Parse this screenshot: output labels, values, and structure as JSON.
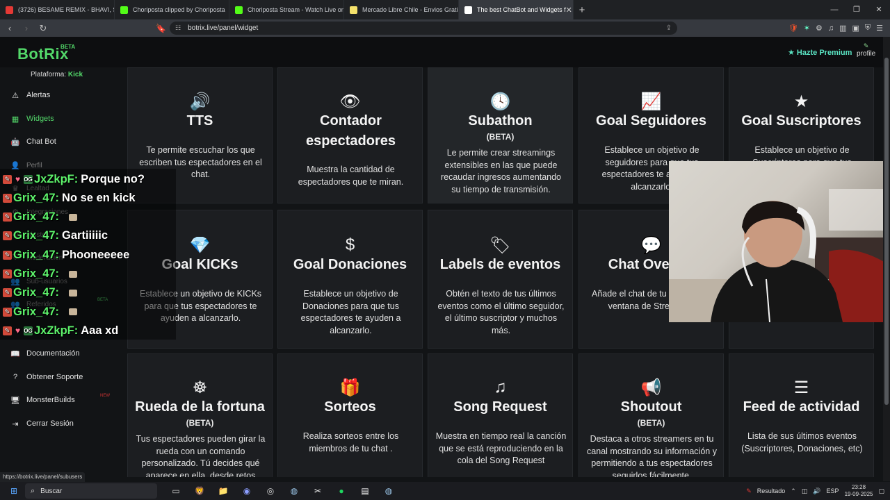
{
  "browser": {
    "tabs": [
      {
        "label": "(3726) BESAME REMIX - BHAVI, S",
        "color": "#e53935"
      },
      {
        "label": "Choriposta clipped by Choriposta",
        "color": "#53fc18"
      },
      {
        "label": "Choriposta Stream - Watch Live on K",
        "color": "#53fc18"
      },
      {
        "label": "Mercado Libre Chile - Envios Gratis e",
        "color": "#f5e26b"
      },
      {
        "label": "The best ChatBot and Widgets f",
        "color": "#ffffff"
      }
    ],
    "url": "botrix.live/panel/widget",
    "status_url": "https://botrix.live/panel/subusers"
  },
  "header": {
    "logo": "BotRix",
    "beta": "BETA",
    "premium": "Hazte Premium",
    "profile": "profile"
  },
  "sidebar": {
    "platform_label": "Plataforma:",
    "platform_value": "Kick",
    "items": [
      {
        "label": "Alertas",
        "icon": "warning-icon",
        "glyph": "⚠"
      },
      {
        "label": "Widgets",
        "icon": "grid-icon",
        "glyph": "▦"
      },
      {
        "label": "Chat Bot",
        "icon": "robot-icon",
        "glyph": "🤖"
      },
      {
        "label": "Perfil",
        "icon": "user-icon",
        "glyph": "👤"
      },
      {
        "label": "Lealtad",
        "icon": "loyalty-icon",
        "glyph": "♛"
      },
      {
        "label": "Integraciones",
        "icon": "plug-icon",
        "glyph": "⚙"
      },
      {
        "label": "Ajustes",
        "icon": "settings-icon",
        "glyph": "⚙"
      },
      {
        "label": "Moderación",
        "icon": "shield-icon",
        "glyph": "⛨"
      },
      {
        "label": "Sub-usuarios",
        "icon": "users-icon",
        "glyph": "👥"
      },
      {
        "label": "Referidos",
        "icon": "referral-icon",
        "glyph": "👥"
      },
      {
        "label": "Documentación",
        "icon": "book-icon",
        "glyph": "📖"
      },
      {
        "label": "Obtener Soporte",
        "icon": "help-icon",
        "glyph": "?"
      },
      {
        "label": "MonsterBuilds",
        "icon": "monitor-icon",
        "glyph": "🖥"
      },
      {
        "label": "Cerrar Sesión",
        "icon": "logout-icon",
        "glyph": "⇥"
      }
    ],
    "new_badge": "NEW",
    "beta_badge": "BETA"
  },
  "widgets": [
    {
      "title": "TTS",
      "beta": "",
      "desc": "Te permite escuchar los que escriben tus espectadores en el chat.",
      "icon": "speaker-icon",
      "glyph": "🔊"
    },
    {
      "title": "Contador espectadores",
      "beta": "",
      "desc": "Muestra la cantidad de espectadores que te miran.",
      "icon": "eye-icon",
      "glyph": "👁"
    },
    {
      "title": "Subathon",
      "beta": "(BETA)",
      "desc": "Le permite crear streamings extensibles en las que puede recaudar ingresos aumentando su tiempo de transmisión.",
      "icon": "clock-icon",
      "glyph": "🕓"
    },
    {
      "title": "Goal Seguidores",
      "beta": "",
      "desc": "Establece un objetivo de seguidores para que tus espectadores te ayuden a alcanzarlo.",
      "icon": "chart-line-icon",
      "glyph": "📈"
    },
    {
      "title": "Goal Suscriptores",
      "beta": "",
      "desc": "Establece un objetivo de Suscriptores para que tus espectadores te ayuden a alcanzarlo.",
      "icon": "star-icon",
      "glyph": "★"
    },
    {
      "title": "Goal KICKs",
      "beta": "",
      "desc": "Establece un objetivo de KICKs para que tus espectadores te ayuden a alcanzarlo.",
      "icon": "diamond-icon",
      "glyph": "💎"
    },
    {
      "title": "Goal Donaciones",
      "beta": "",
      "desc": "Establece un objetivo de Donaciones para que tus espectadores te ayuden a alcanzarlo.",
      "icon": "dollar-icon",
      "glyph": "$"
    },
    {
      "title": "Labels de eventos",
      "beta": "",
      "desc": "Obtén el texto de tus últimos eventos como el último seguidor, el último suscriptor y muchos más.",
      "icon": "tags-icon",
      "glyph": "🏷"
    },
    {
      "title": "Chat Overlay",
      "beta": "",
      "desc": "Añade el chat de tu stream a la ventana de Streaming.",
      "icon": "comment-icon",
      "glyph": "💬"
    },
    {
      "title": "",
      "beta": "",
      "desc": "",
      "icon": "",
      "glyph": ""
    },
    {
      "title": "Rueda de la fortuna",
      "beta": "(BETA)",
      "desc": "Tus espectadores pueden girar la rueda con un comando personalizado. Tú decides qué aparece en ella, desde retos hasta",
      "icon": "wheel-icon",
      "glyph": "☸"
    },
    {
      "title": "Sorteos",
      "beta": "",
      "desc": "Realiza sorteos entre los miembros de tu chat .",
      "icon": "gifts-icon",
      "glyph": "🎁"
    },
    {
      "title": "Song Request",
      "beta": "",
      "desc": "Muestra en tiempo real la canción que se está reproduciendo en la cola del Song Request",
      "icon": "music-icon",
      "glyph": "♫"
    },
    {
      "title": "Shoutout",
      "beta": "(BETA)",
      "desc": "Destaca a otros streamers en tu canal mostrando su información y permitiendo a tus espectadores seguirlos fácilmente.",
      "icon": "megaphone-icon",
      "glyph": "📢"
    },
    {
      "title": "Feed de actividad",
      "beta": "",
      "desc": "Lista de sus últimos eventos (Suscriptores, Donaciones, etc)",
      "icon": "list-icon",
      "glyph": "☰"
    }
  ],
  "chat": [
    {
      "user": "JxZkpF:",
      "msg": "Porque no?",
      "og": true,
      "emote": false
    },
    {
      "user": "Grix_47:",
      "msg": "No se en kick",
      "og": false,
      "emote": false
    },
    {
      "user": "Grix_47:",
      "msg": "",
      "og": false,
      "emote": true
    },
    {
      "user": "Grix_47:",
      "msg": "Gartiiiiic",
      "og": false,
      "emote": false
    },
    {
      "user": "Grix_47:",
      "msg": "Phooneeeee",
      "og": false,
      "emote": false
    },
    {
      "user": "Grix_47:",
      "msg": "",
      "og": false,
      "emote": true
    },
    {
      "user": "Grix_47:",
      "msg": "",
      "og": false,
      "emote": true
    },
    {
      "user": "Grix_47:",
      "msg": "",
      "og": false,
      "emote": true
    },
    {
      "user": "JxZkpF:",
      "msg": "Aaa xd",
      "og": true,
      "emote": false
    }
  ],
  "taskbar": {
    "search": "Buscar",
    "weather": "Resultado",
    "lang": "ESP",
    "time": "23:28",
    "date": "19-09-2025"
  }
}
